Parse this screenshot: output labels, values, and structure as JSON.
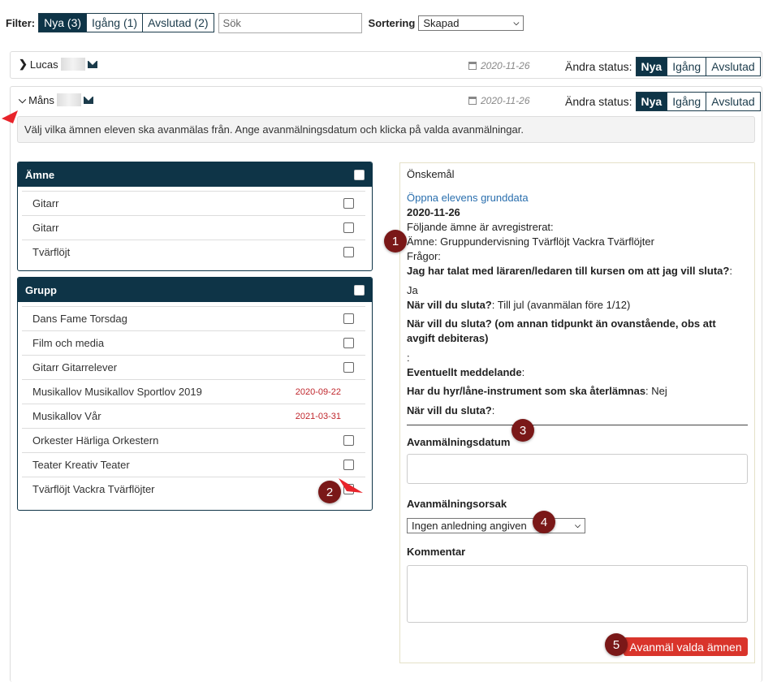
{
  "filter": {
    "label": "Filter:",
    "tabs": [
      {
        "label": "Nya (3)"
      },
      {
        "label": "Igång (1)"
      },
      {
        "label": "Avslutad (2)"
      }
    ],
    "search_placeholder": "Sök",
    "sort_label": "Sortering",
    "sort_value": "Skapad"
  },
  "students": [
    {
      "name": "Lucas",
      "date": "2020-11-26",
      "status_label": "Ändra status:",
      "statuses": [
        "Nya",
        "Igång",
        "Avslutad"
      ]
    },
    {
      "name": "Måns",
      "date": "2020-11-26",
      "status_label": "Ändra status:",
      "statuses": [
        "Nya",
        "Igång",
        "Avslutad"
      ]
    }
  ],
  "instruction": "Välj vilka ämnen eleven ska avanmälas från. Ange avanmälningsdatum och klicka på valda avanmälningar.",
  "subjects": {
    "header": "Ämne",
    "items": [
      {
        "label": "Gitarr"
      },
      {
        "label": "Gitarr"
      },
      {
        "label": "Tvärflöjt"
      }
    ]
  },
  "groups": {
    "header": "Grupp",
    "items": [
      {
        "label": "Dans Fame Torsdag",
        "date": ""
      },
      {
        "label": "Film och media",
        "date": ""
      },
      {
        "label": "Gitarr Gitarrelever",
        "date": ""
      },
      {
        "label": "Musikallov Musikallov Sportlov 2019",
        "date": "2020-09-22"
      },
      {
        "label": "Musikallov Vår",
        "date": "2021-03-31"
      },
      {
        "label": "Orkester Härliga Orkestern",
        "date": ""
      },
      {
        "label": "Teater Kreativ Teater",
        "date": ""
      },
      {
        "label": "Tvärflöjt Vackra Tvärflöjter",
        "date": ""
      }
    ]
  },
  "request": {
    "title": "Önskemål",
    "link": "Öppna elevens grunddata",
    "date": "2020-11-26",
    "line1": "Följande ämne är avregistrerat:",
    "line2": "Ämne: Gruppundervisning Tvärflöjt Vackra Tvärflöjter",
    "line3": "Frågor:",
    "q1": "Jag har talat med läraren/ledaren till kursen om att jag vill sluta?",
    "q1_colon": ":",
    "a1": "Ja",
    "q2": "När vill du sluta?",
    "a2": ": Till jul (avanmälan före 1/12)",
    "q3": "När vill du sluta? (om annan tidpunkt än ovanstående, obs att avgift debiteras)",
    "a3": ":",
    "q4": "Eventuellt meddelande",
    "a4": ":",
    "q5": "Har du hyr/låne-instrument som ska återlämnas",
    "a5": ": Nej",
    "q6": "När vill du sluta?",
    "a6": ":"
  },
  "form": {
    "date_label": "Avanmälningsdatum",
    "reason_label": "Avanmälningsorsak",
    "reason_value": "Ingen anledning angiven",
    "comment_label": "Kommentar",
    "submit_label": "Avanmäl valda ämnen"
  },
  "badges": [
    "1",
    "2",
    "3",
    "4",
    "5"
  ],
  "colors": {
    "primary": "#0e3447",
    "badge": "#7a1818",
    "danger": "#d9342b",
    "date_red": "#c0272d",
    "arrow": "#e8232a"
  }
}
